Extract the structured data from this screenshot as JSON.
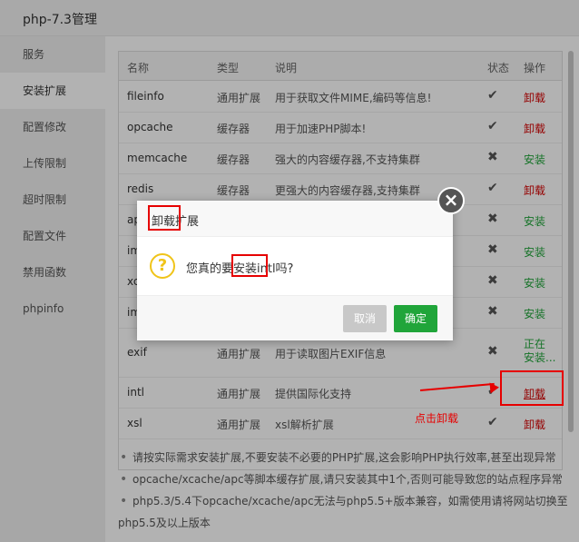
{
  "window": {
    "title": "php-7.3管理"
  },
  "sidebar": {
    "items": [
      {
        "label": "服务"
      },
      {
        "label": "安装扩展",
        "active": true
      },
      {
        "label": "配置修改"
      },
      {
        "label": "上传限制"
      },
      {
        "label": "超时限制"
      },
      {
        "label": "配置文件"
      },
      {
        "label": "禁用函数"
      },
      {
        "label": "phpinfo"
      }
    ]
  },
  "table": {
    "headers": {
      "name": "名称",
      "type": "类型",
      "desc": "说明",
      "status": "状态",
      "op": "操作"
    },
    "rows": [
      {
        "name": "fileinfo",
        "type": "通用扩展",
        "desc": "用于获取文件MIME,编码等信息!",
        "status": "✔",
        "op": "卸载"
      },
      {
        "name": "opcache",
        "type": "缓存器",
        "desc": "用于加速PHP脚本!",
        "status": "✔",
        "op": "卸载"
      },
      {
        "name": "memcache",
        "type": "缓存器",
        "desc": "强大的内容缓存器,不支持集群",
        "status": "✖",
        "op": "安装"
      },
      {
        "name": "redis",
        "type": "缓存器",
        "desc": "更强大的内容缓存器,支持集群",
        "status": "✔",
        "op": "卸载"
      },
      {
        "name": "ap",
        "type": "",
        "desc": "",
        "status": "✖",
        "op": "安装"
      },
      {
        "name": "im",
        "type": "",
        "desc": "",
        "status": "✖",
        "op": "安装"
      },
      {
        "name": "xc",
        "type": "",
        "desc": "",
        "status": "✖",
        "op": "安装"
      },
      {
        "name": "im",
        "type": "",
        "desc": "",
        "status": "✖",
        "op": "安装"
      },
      {
        "name": "exif",
        "type": "通用扩展",
        "desc": "用于读取图片EXIF信息",
        "status": "✖",
        "op_line1": "正在",
        "op_line2": "安装..."
      },
      {
        "name": "intl",
        "type": "通用扩展",
        "desc": "提供国际化支持",
        "status": "✔",
        "op": "卸载"
      },
      {
        "name": "xsl",
        "type": "通用扩展",
        "desc": "xsl解析扩展",
        "status": "✔",
        "op": "卸载"
      }
    ]
  },
  "notes": [
    "请按实际需求安装扩展,不要安装不必要的PHP扩展,这会影响PHP执行效率,甚至出现异常",
    "opcache/xcache/apc等脚本缓存扩展,请只安装其中1个,否则可能导致您的站点程序异常",
    "php5.3/5.4下opcache/xcache/apc无法与php5.5+版本兼容，如需使用请将网站切换至",
    "php5.5及以上版本"
  ],
  "dialog": {
    "title": "卸载扩展",
    "message": "您真的要安装intl吗?",
    "cancel_label": "取消",
    "ok_label": "确定",
    "close_glyph": "×",
    "question_glyph": "?"
  },
  "annotation": {
    "text": "点击卸载"
  },
  "colors": {
    "install": "#20a53a",
    "uninstall": "#d60000",
    "annotation": "#e60000"
  }
}
